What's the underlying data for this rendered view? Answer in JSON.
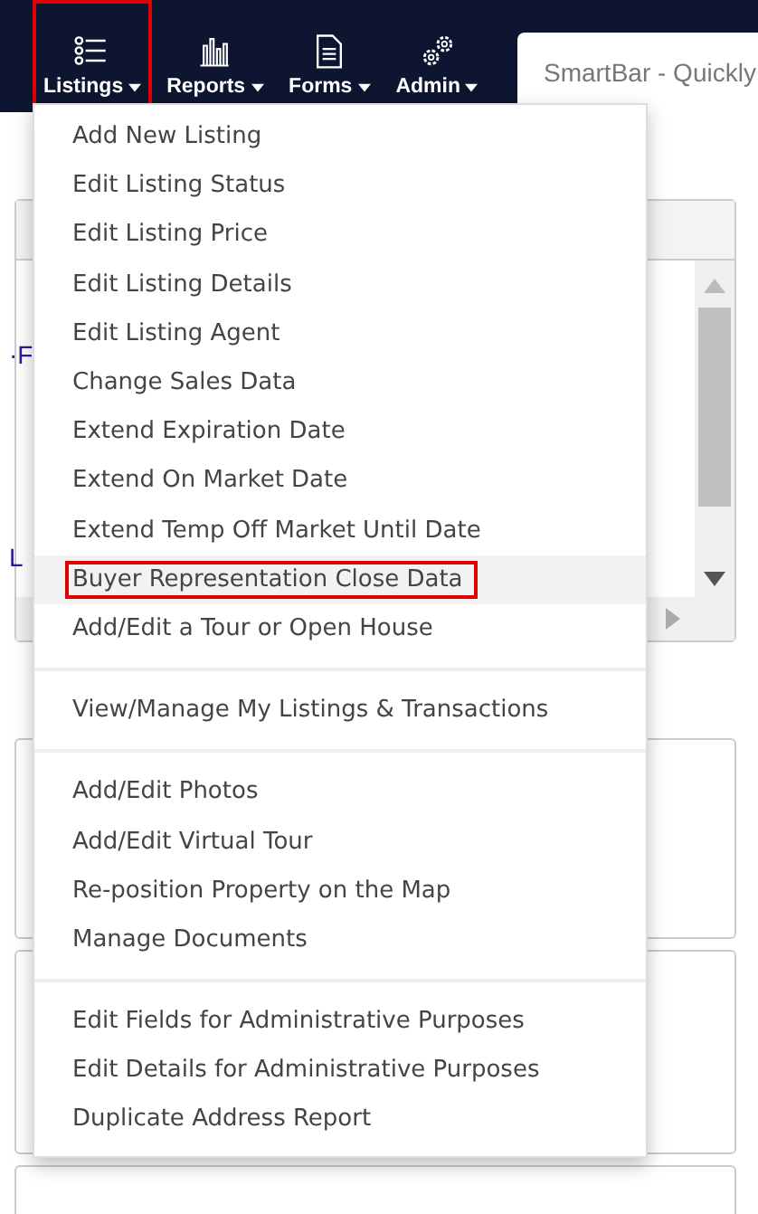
{
  "navbar": {
    "items": [
      {
        "label": "Listings",
        "highlighted": true
      },
      {
        "label": "Reports",
        "highlighted": false
      },
      {
        "label": "Forms",
        "highlighted": false
      },
      {
        "label": "Admin",
        "highlighted": false
      }
    ],
    "search": {
      "placeholder": "SmartBar - Quickly"
    }
  },
  "background": {
    "panel_texts": [
      "·F",
      "L"
    ]
  },
  "menu": {
    "groups": [
      [
        {
          "label": "Add New Listing",
          "hovered": false,
          "highlighted": false
        },
        {
          "label": "Edit Listing Status",
          "hovered": false,
          "highlighted": false
        },
        {
          "label": "Edit Listing Price",
          "hovered": false,
          "highlighted": false
        },
        {
          "label": "Edit Listing Details",
          "hovered": false,
          "highlighted": false
        },
        {
          "label": "Edit Listing Agent",
          "hovered": false,
          "highlighted": false
        },
        {
          "label": "Change Sales Data",
          "hovered": false,
          "highlighted": false
        },
        {
          "label": "Extend Expiration Date",
          "hovered": false,
          "highlighted": false
        },
        {
          "label": "Extend On Market Date",
          "hovered": false,
          "highlighted": false
        },
        {
          "label": "Extend Temp Off Market Until Date",
          "hovered": false,
          "highlighted": false
        },
        {
          "label": "Buyer Representation Close Data",
          "hovered": true,
          "highlighted": true
        },
        {
          "label": "Add/Edit a Tour or Open House",
          "hovered": false,
          "highlighted": false
        }
      ],
      [
        {
          "label": "View/Manage My Listings & Transactions",
          "hovered": false,
          "highlighted": false
        }
      ],
      [
        {
          "label": "Add/Edit Photos",
          "hovered": false,
          "highlighted": false
        },
        {
          "label": "Add/Edit Virtual Tour",
          "hovered": false,
          "highlighted": false
        },
        {
          "label": "Re-position Property on the Map",
          "hovered": false,
          "highlighted": false
        },
        {
          "label": "Manage Documents",
          "hovered": false,
          "highlighted": false
        }
      ],
      [
        {
          "label": "Edit Fields for Administrative Purposes",
          "hovered": false,
          "highlighted": false
        },
        {
          "label": "Edit Details for Administrative Purposes",
          "hovered": false,
          "highlighted": false
        },
        {
          "label": "Duplicate Address Report",
          "hovered": false,
          "highlighted": false
        }
      ]
    ]
  }
}
